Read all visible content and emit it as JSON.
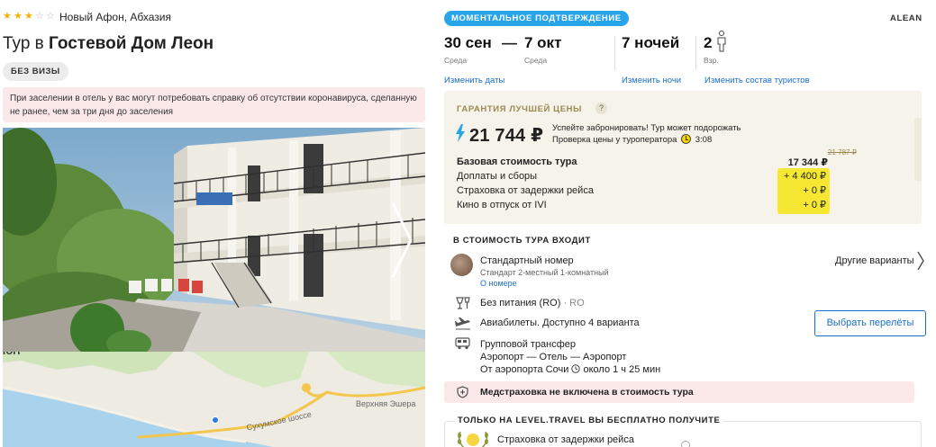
{
  "hotel": {
    "stars": 3,
    "stars_max": 5,
    "location": "Новый Афон, Абхазия",
    "title_prefix": "Тур в",
    "title_name": "Гостевой Дом Леон",
    "visa_badge": "БЕЗ ВИЗЫ",
    "covid_note": "При заселении в отель у вас могут потребовать справку об отсутствии коронавируса, сделанную не ранее, чем за три дня до заселения"
  },
  "map": {
    "labels": [
      "Верхняя Эшера",
      "Сухумское шоссе",
      "ЮН"
    ]
  },
  "tour": {
    "confirm_badge": "МОМЕНТАЛЬНОЕ ПОДТВЕРЖДЕНИЕ",
    "operator": "ALEAN",
    "date_from": "30 сен",
    "date_from_day": "Среда",
    "date_dash": "—",
    "date_to": "7 окт",
    "date_to_day": "Среда",
    "nights": "7 ночей",
    "adults": "2",
    "adults_label": "Взр.",
    "change_dates": "Изменить даты",
    "change_nights": "Изменить ночи",
    "change_tourists": "Изменить состав туристов"
  },
  "price": {
    "guarantee_label": "ГАРАНТИЯ ЛУЧШЕЙ ЦЕНЫ",
    "help_icon": "?",
    "total": "21 744 ₽",
    "hurry_line1": "Успейте забронировать! Тур может подорожать",
    "hurry_line2": "Проверка цены у туроператора",
    "timer": "3:08",
    "old_price": "21 787 ₽",
    "base_label": "Базовая стоимость тура",
    "base_value": "17 344 ₽",
    "rows": [
      {
        "label": "Доплаты и сборы",
        "value": "+ 4 400 ₽"
      },
      {
        "label": "Страховка от задержки рейса",
        "value": "+ 0 ₽"
      },
      {
        "label": "Кино в отпуск от IVI",
        "value": "+ 0 ₽"
      }
    ],
    "highlight_color": "#f6e832"
  },
  "included": {
    "title": "В СТОИМОСТЬ ТУРА ВХОДИТ",
    "room_name": "Стандартный номер",
    "room_sub": "Стандарт 2-местный 1-комнатный",
    "room_link": "О номере",
    "other_variants": "Другие варианты",
    "meal": "Без питания (RO)",
    "meal_code": "· RO",
    "flights": "Авиабилеты. Доступно 4 варианта",
    "flights_button": "Выбрать перелёты",
    "transfer_title": "Групповой трансфер",
    "transfer_route": "Аэропорт — Отель — Аэропорт",
    "transfer_from": "От аэропорта Сочи",
    "transfer_time": "около 1 ч 25 мин"
  },
  "insurance": {
    "text": "Медстраховка не включена в стоимость тура"
  },
  "free": {
    "title": "ТОЛЬКО НА LEVEL.TRAVEL ВЫ БЕСПЛАТНО ПОЛУЧИТЕ",
    "item": "Страховка от задержки рейса"
  },
  "colors": {
    "accent": "#1a6fc8",
    "badge": "#28a4e8",
    "warning_bg": "#fbe9ea",
    "price_box_bg": "#f5f3ea"
  }
}
